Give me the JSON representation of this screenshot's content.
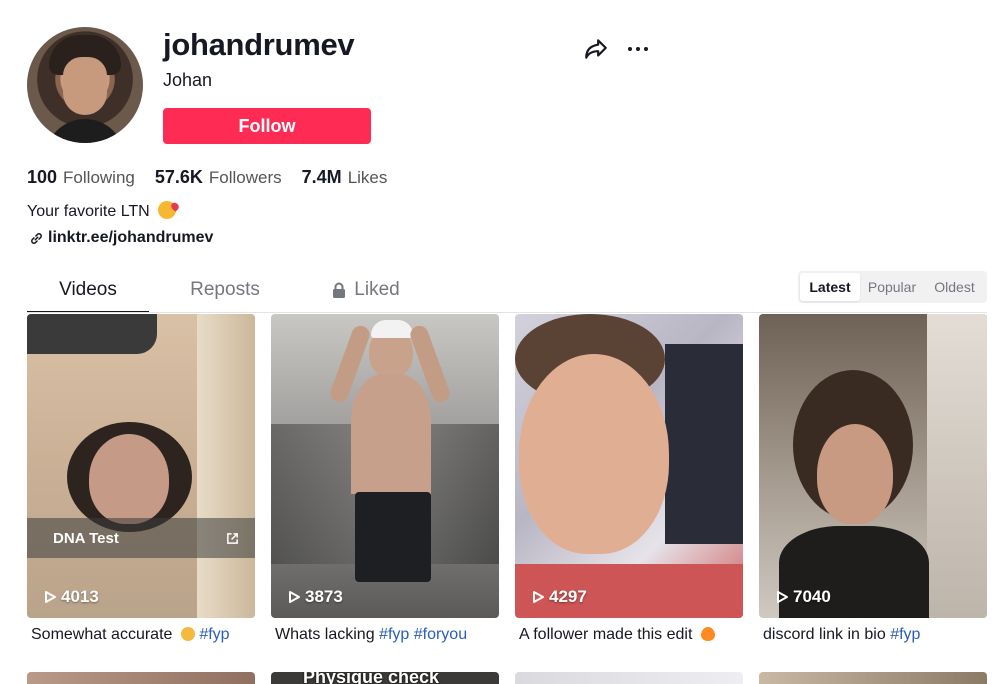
{
  "profile": {
    "username": "johandrumev",
    "nickname": "Johan",
    "follow_label": "Follow",
    "bio": "Your favorite LTN",
    "link": "linktr.ee/johandrumev",
    "accent_color": "#fe2c55"
  },
  "stats": {
    "following": {
      "value": "100",
      "label": "Following"
    },
    "followers": {
      "value": "57.6K",
      "label": "Followers"
    },
    "likes": {
      "value": "7.4M",
      "label": "Likes"
    }
  },
  "tabs": [
    {
      "label": "Videos",
      "active": true
    },
    {
      "label": "Reposts",
      "active": false
    },
    {
      "label": "Liked",
      "active": false,
      "icon": "lock-icon"
    }
  ],
  "sort": {
    "options": [
      "Latest",
      "Popular",
      "Oldest"
    ],
    "selected": "Latest"
  },
  "videos": [
    {
      "views": "4013",
      "overlay": "DNA Test",
      "caption_text": "Somewhat accurate",
      "caption_tags": "#fyp"
    },
    {
      "views": "3873",
      "caption_text": "Whats lacking",
      "caption_tags": "#fyp #foryou"
    },
    {
      "views": "4297",
      "caption_text": "A follower made this edit",
      "caption_tags": ""
    },
    {
      "views": "7040",
      "caption_text": "discord link in bio",
      "caption_tags": "#fyp"
    }
  ],
  "row2": {
    "overlay_text": "Physique check"
  },
  "icons": {
    "share": "share-icon",
    "more": "more-icon",
    "link": "link-icon",
    "play": "play-icon",
    "external": "external-link-icon"
  }
}
